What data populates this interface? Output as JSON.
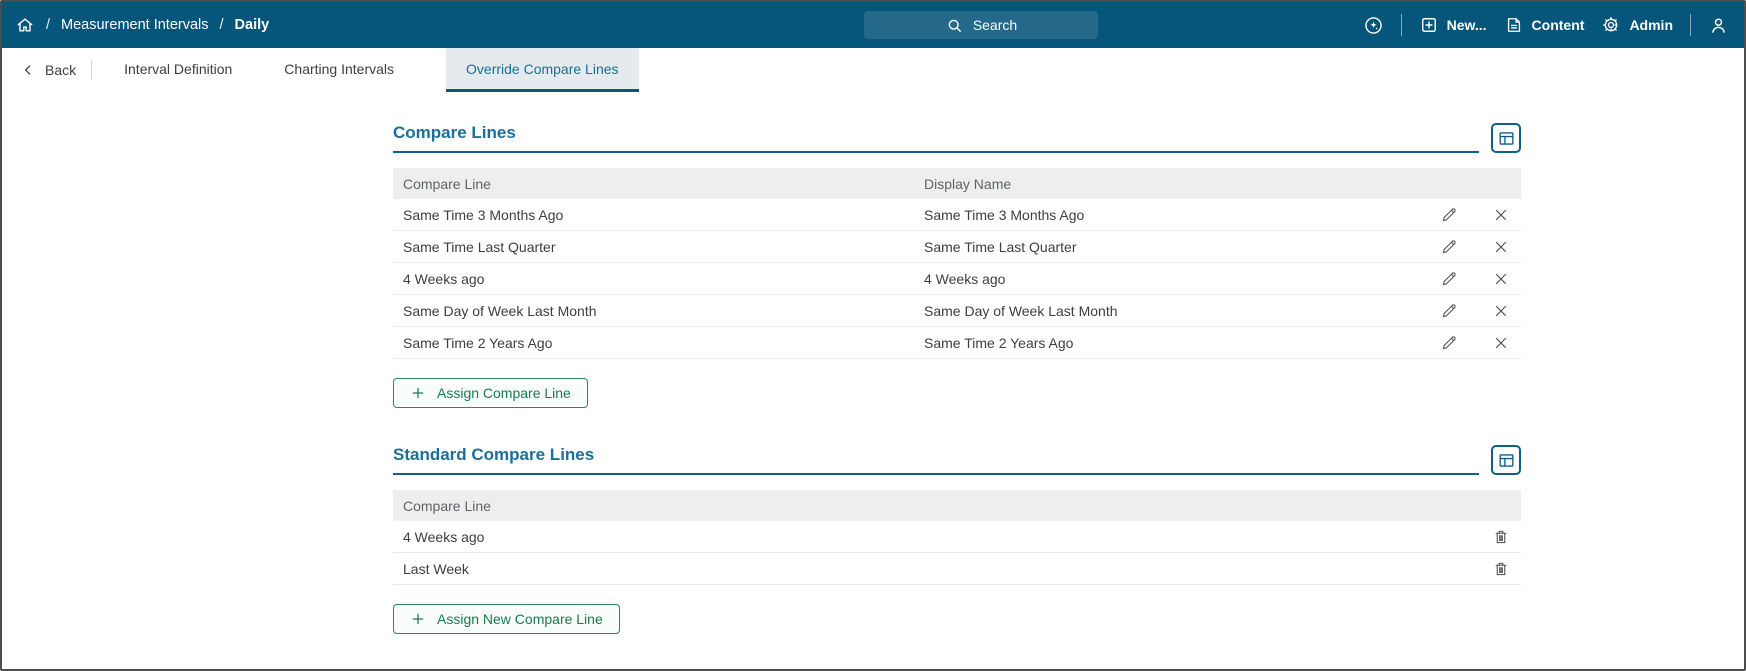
{
  "header": {
    "breadcrumb": {
      "separator": "/",
      "items": [
        {
          "label": "Measurement Intervals"
        },
        {
          "label": "Daily"
        }
      ]
    },
    "search": {
      "label": "Search"
    },
    "actions": {
      "new": "New...",
      "content": "Content",
      "admin": "Admin"
    }
  },
  "tabbar": {
    "back": "Back",
    "tabs": [
      {
        "label": "Interval Definition"
      },
      {
        "label": "Charting Intervals"
      },
      {
        "label": "Override Compare Lines"
      }
    ],
    "active_tab": "Override Compare Lines"
  },
  "sections": {
    "compare_lines": {
      "title": "Compare Lines",
      "columns": {
        "compare_line": "Compare Line",
        "display_name": "Display Name"
      },
      "rows": [
        {
          "compare_line": "Same Time 3 Months Ago",
          "display_name": "Same Time 3 Months Ago"
        },
        {
          "compare_line": "Same Time Last Quarter",
          "display_name": "Same Time Last Quarter"
        },
        {
          "compare_line": "4 Weeks ago",
          "display_name": "4 Weeks ago"
        },
        {
          "compare_line": "Same Day of Week Last Month",
          "display_name": "Same Day of Week Last Month"
        },
        {
          "compare_line": "Same Time 2 Years Ago",
          "display_name": "Same Time 2 Years Ago"
        }
      ],
      "assign_button": "Assign Compare Line"
    },
    "standard_compare_lines": {
      "title": "Standard Compare Lines",
      "columns": {
        "compare_line": "Compare Line"
      },
      "rows": [
        {
          "compare_line": "4 Weeks ago"
        },
        {
          "compare_line": "Last Week"
        }
      ],
      "assign_button": "Assign New Compare Line"
    }
  },
  "icons": {
    "home": "home-icon",
    "search": "search-icon",
    "sparkle": "sparkle-icon",
    "new": "plus-square-icon",
    "content": "document-icon",
    "admin": "gear-icon",
    "user": "person-icon",
    "back": "chevron-left-icon",
    "table_settings": "table-grid-icon",
    "edit": "pencil-icon",
    "remove": "close-x-icon",
    "delete": "trash-icon"
  },
  "colors": {
    "header_bg": "#05567a",
    "search_bg": "#24688a",
    "accent_teal": "#1b6f9a",
    "underline_teal": "#0c5876",
    "active_tab_bg": "#e4eaed",
    "button_green_text": "#187a4e",
    "button_green_border": "#2c8a5e",
    "table_header_bg": "#eeeeee"
  }
}
